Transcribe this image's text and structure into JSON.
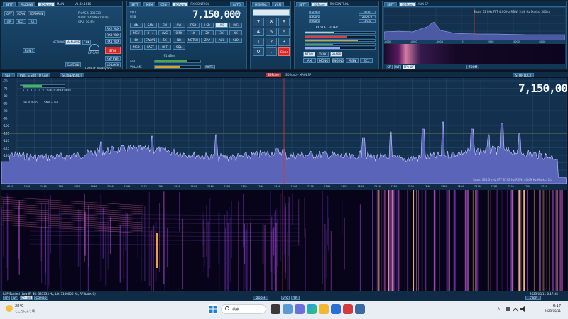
{
  "top_panels": {
    "p1": {
      "tabs": [
        "SETT",
        "PLUGINS",
        "SDRuno",
        "MAIN",
        "V1.42.1616"
      ],
      "status": {
        "prof_sr": "Prof SR: 333333",
        "ifbw": "IFBW: 0.400MHz (LIF)",
        "cpu": "CPU: 16.9%"
      },
      "buttons": [
        "OPT",
        "SCAN",
        "SDRMAIN",
        "GPI",
        "RX1",
        "RX"
      ],
      "btn_rx2": "RX2 VRX",
      "btn_rx3": "RX3 VRX",
      "btn_rx4": "RX4 VRX",
      "btn_stop": "STOP",
      "btn_lo_lock": "LO LOCK",
      "btn_rsp": "RSP PWR",
      "btn_run": "RUN 1",
      "btn_save": "SAVE INI",
      "btn_ch": "CHK",
      "lbl_network": "NETWORK",
      "btn_ntwk": "MAN-UVE",
      "lbl_rfgain": "RF GAIN",
      "workspace": "Default Workspace",
      "lbl_rfgain2": "RF GAIN"
    },
    "p2": {
      "tabs": [
        "SETT",
        "MEM",
        "CEN",
        "SDRuno",
        "RX CONTROL",
        "AUTO"
      ],
      "mode_label": "USB",
      "vfo_label": "VFO",
      "freq": "7,150,000",
      "freq_small": "MHz",
      "modes": [
        "AM",
        "SAM",
        "FM",
        "CW",
        "DSB",
        "LSB",
        "USB",
        "DIG"
      ],
      "bw_label": "FILTER",
      "steps": [
        "MCV",
        "8 - 4",
        "AVG",
        "0.5K",
        "1K",
        "2K",
        "3K",
        "4K",
        "6K",
        "CWAVE",
        "5K",
        "NB",
        "NOTCH",
        "ZAP",
        "AGC",
        "SLO",
        "MED",
        "FAST",
        "OFF",
        "SQL"
      ],
      "agc_label": "AGC",
      "volume_label": "VOLUME",
      "signal_label": "-91 dBm",
      "btn_mute": "MUTE"
    },
    "p3": {
      "tabs": [
        "MEMPNL",
        "VCM"
      ],
      "keys": [
        "7",
        "8",
        "9",
        "4",
        "5",
        "6",
        "1",
        "2",
        "3",
        "0",
        ".",
        "Clear"
      ],
      "btn_back": "BACK",
      "btn_enter": "Enter",
      "btn_zoom": "ZOOM",
      "mhz": "MHz"
    },
    "p4": {
      "tabs": [
        "SETT",
        "SDRuno",
        "RX CONTROL"
      ],
      "rows": [
        "MHz",
        "FREQ",
        "NOISE",
        "SQL",
        "AF",
        "RF",
        "AGC",
        "CW"
      ],
      "val_labels": [
        "1500.0",
        "1300.0",
        "2000.0",
        "0.00",
        "2000.0",
        "100.0"
      ],
      "btn_rf": "RF SOFT FILTER",
      "btn_ntwk": "NTWK",
      "btn_oflk": "OFLK",
      "btn_sharp": "SHARP",
      "notch": [
        "NR",
        "NB1",
        "NB2",
        "FAST",
        "AUTO"
      ],
      "btns2": [
        "AM",
        "MONO",
        "ENG-ND",
        "PBSN",
        "BCL"
      ]
    },
    "p5": {
      "tabs": [
        "SETT",
        "SDRuno",
        "AUX SP"
      ],
      "readout": "Span: 12 kHz   FFT 4.00 Hz   RBW: 5.86 Hz   Marks: 300 tr",
      "ticks": [
        "-6000",
        "-4000",
        "-2000",
        "0",
        "2000",
        "4000",
        "6000"
      ],
      "btns": [
        "SP",
        "WF",
        "SP+WF"
      ],
      "zoom": "ZOOM"
    }
  },
  "main_section": {
    "tabs": [
      "SETT",
      "FWD & SRR TO CAV",
      "SCREENSHOT"
    ],
    "title": "SDRuno - MAIN SP",
    "stop_lock": "STOP LOCK",
    "freq": "7,150,000",
    "dbm": "dBm",
    "signal": "-95.4 dBm",
    "smeter_ticks": [
      "S",
      "1",
      "3",
      "5",
      "7",
      "9",
      "+10",
      "+20",
      "+30",
      "+40",
      "+50",
      "+60"
    ],
    "snr": "SNR -- dB",
    "y_axis": [
      "-70",
      "-75",
      "-80",
      "-85",
      "-90",
      "-95",
      "-100",
      "-105",
      "-110",
      "-115",
      "-120",
      "-125",
      "-130",
      "-135"
    ],
    "x_axis": [
      "6990",
      "7000",
      "7010",
      "7020",
      "7030",
      "7040",
      "7050",
      "7060",
      "7070",
      "7080",
      "7090",
      "7100",
      "7110",
      "7120",
      "7130",
      "7140",
      "7150",
      "7160",
      "7170",
      "7180",
      "7190",
      "7200",
      "7210",
      "7220",
      "7230",
      "7240",
      "7250",
      "7260",
      "7270",
      "7280",
      "7290",
      "7300",
      "7310"
    ],
    "footer_info": "Span: 333.3 kHz   FFT 8192 Hz   RBW: 40.69 Hz   Marks: 1 tr"
  },
  "status_bar": {
    "left": "RSP Started (Low IF, SR: 333333 Hz, LO: 7150000 Hz, RFState: 0)",
    "right": "2023/06/11 6:17:08",
    "btns": [
      "SP",
      "WF",
      "SP+WF",
      "COMBO"
    ],
    "zoom": "ZOOM",
    "vfo_lock": "VFO",
    "tr": "TR",
    "center": "MAIN SP",
    "stop": "STOP"
  },
  "taskbar": {
    "weather_temp": "28°C",
    "weather_desc": "ところにより晴",
    "search": "検索",
    "time": "6:17",
    "date": "2023/06/11"
  },
  "colors": {
    "accent": "#2e6fa1",
    "spectrum_fill": "#5b63b7",
    "red_line": "#d43a3a",
    "stop_btn": "#d42a2a"
  }
}
